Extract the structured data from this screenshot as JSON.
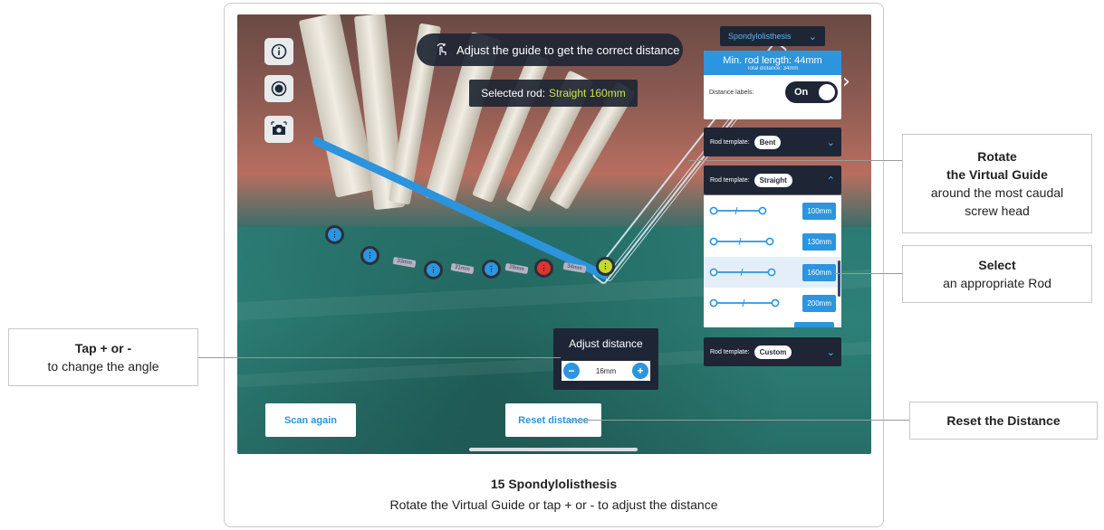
{
  "screen": {
    "instruction": "Adjust the guide to get the correct distance",
    "selected_rod_label": "Selected rod:",
    "selected_rod_value": "Straight 160mm",
    "top_dropdown": "Spondylolisthesis",
    "min_rod": {
      "length": "Min. rod length: 44mm",
      "total": "Total distance: 34mm",
      "distance_labels": "Distance labels:",
      "toggle": "On"
    },
    "templates": [
      {
        "label": "Rod template:",
        "value": "Bent"
      },
      {
        "label": "Rod template:",
        "value": "Straight"
      },
      {
        "label": "Rod template:",
        "value": "Custom"
      }
    ],
    "rods": [
      "100mm",
      "130mm",
      "160mm",
      "200mm"
    ],
    "selected_rod_index": 2,
    "distance_labels": [
      "33mm",
      "31mm",
      "29mm",
      "34mm"
    ],
    "adjust": {
      "title": "Adjust distance",
      "value": "16mm",
      "minus": "−",
      "plus": "+"
    },
    "buttons": {
      "scan_again": "Scan again",
      "reset_distance": "Reset distance"
    }
  },
  "callouts": {
    "rotate_title_1": "Rotate",
    "rotate_title_2": "the Virtual Guide",
    "rotate_body_1": "around the most caudal",
    "rotate_body_2": "screw head",
    "select_title": "Select",
    "select_body": "an appropriate Rod",
    "tap_title": "Tap + or -",
    "tap_body": "to change the angle",
    "reset": "Reset the Distance"
  },
  "caption": {
    "title": "15 Spondylolisthesis",
    "body": "Rotate the Virtual Guide or tap + or - to adjust the distance"
  },
  "colors": {
    "accent": "#2c95df",
    "panel": "#1e2636",
    "selected_value": "#c7e54a"
  }
}
